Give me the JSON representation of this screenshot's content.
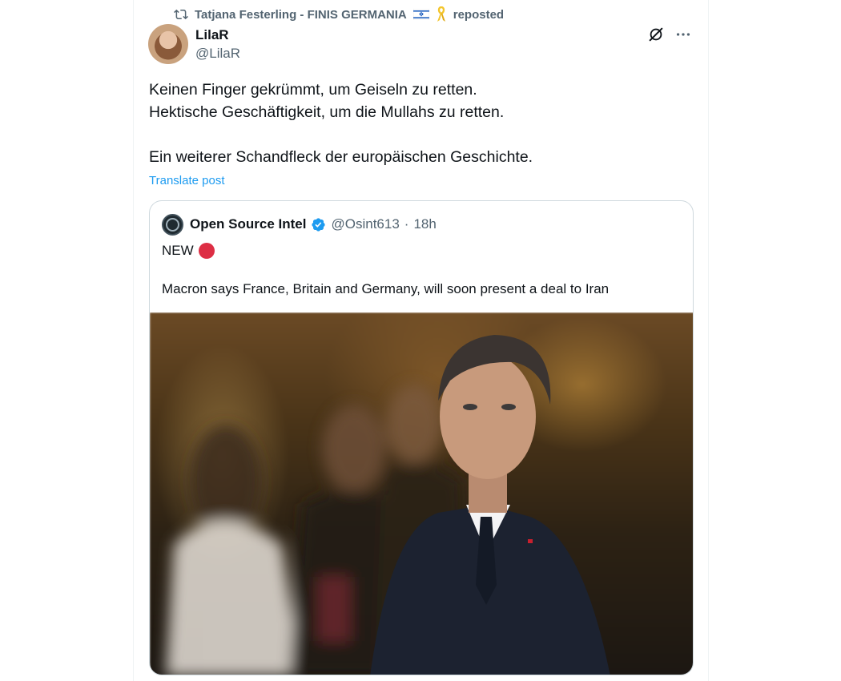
{
  "repost": {
    "reposter_name": "Tatjana Festerling - FINIS GERMANIA",
    "reposted_label": "reposted",
    "flag_icon": "israel-flag-icon",
    "ribbon_icon": "yellow-ribbon-icon"
  },
  "author": {
    "name": "LilaR",
    "handle": "@LilaR"
  },
  "post": {
    "line1": "Keinen Finger gekrümmt, um Geiseln zu retten.",
    "line2": "Hektische Geschäftigkeit, um die Mullahs zu retten.",
    "line3": "Ein weiterer Schandfleck der europäischen Geschichte.",
    "translate_label": "Translate post"
  },
  "quote": {
    "name": "Open Source Intel",
    "handle": "@Osint613",
    "separator": "·",
    "time": "18h",
    "text_line1": "NEW",
    "text_line2": "Macron says France, Britain and Germany, will soon present a deal to Iran"
  },
  "colors": {
    "accent": "#1d9bf0",
    "secondary_text": "#536471",
    "border": "#cfd9de",
    "red_circle": "#dd2e44"
  }
}
